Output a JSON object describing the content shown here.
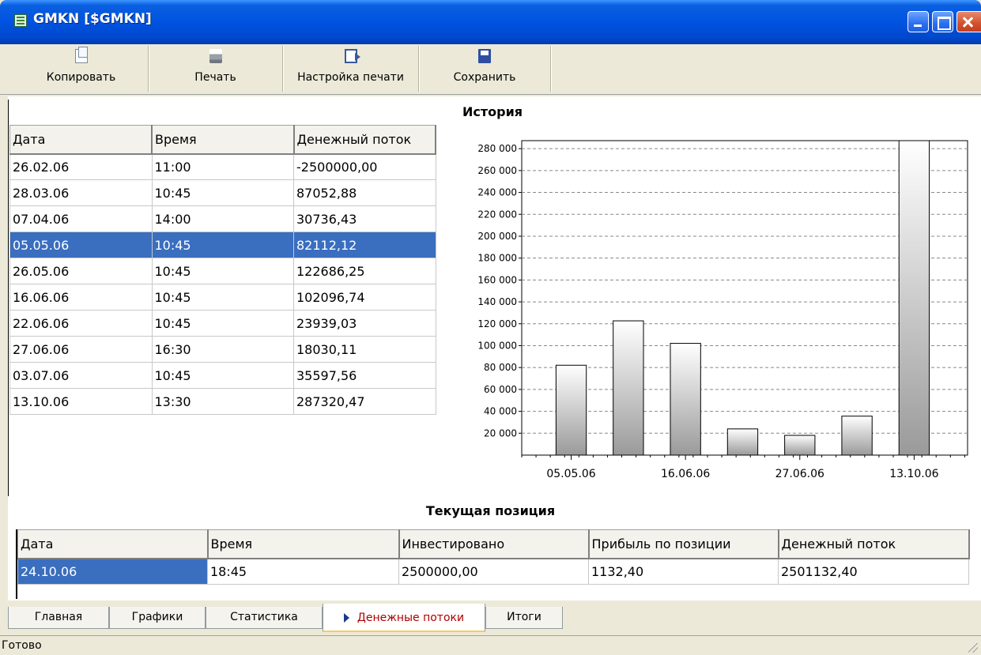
{
  "window": {
    "title": "GMKN [$GMKN]"
  },
  "toolbar": {
    "copy_label": "Копировать",
    "print_label": "Печать",
    "print_setup_label": "Настройка печати",
    "save_label": "Сохранить"
  },
  "history": {
    "columns": [
      "Дата",
      "Время",
      "Денежный поток"
    ],
    "rows": [
      [
        "26.02.06",
        "11:00",
        "-2500000,00"
      ],
      [
        "28.03.06",
        "10:45",
        "87052,88"
      ],
      [
        "07.04.06",
        "14:00",
        "30736,43"
      ],
      [
        "05.05.06",
        "10:45",
        "82112,12"
      ],
      [
        "26.05.06",
        "10:45",
        "122686,25"
      ],
      [
        "16.06.06",
        "10:45",
        "102096,74"
      ],
      [
        "22.06.06",
        "10:45",
        "23939,03"
      ],
      [
        "27.06.06",
        "16:30",
        "18030,11"
      ],
      [
        "03.07.06",
        "10:45",
        "35597,56"
      ],
      [
        "13.10.06",
        "13:30",
        "287320,47"
      ]
    ],
    "selected_row": 3
  },
  "chart_data": {
    "type": "bar",
    "title": "История",
    "categories": [
      "05.05.06",
      "26.05.06",
      "16.06.06",
      "22.06.06",
      "27.06.06",
      "03.07.06",
      "13.10.06"
    ],
    "x_tick_labels": [
      "05.05.06",
      "16.06.06",
      "27.06.06",
      "13.10.06"
    ],
    "values": [
      82112.12,
      122686.25,
      102096.74,
      23939.03,
      18030.11,
      35597.56,
      287320.47
    ],
    "y_ticks": [
      20000,
      40000,
      60000,
      80000,
      100000,
      120000,
      140000,
      160000,
      180000,
      200000,
      220000,
      240000,
      260000,
      280000
    ],
    "y_tick_labels": [
      "20 000",
      "40 000",
      "60 000",
      "80 000",
      "100 000",
      "120 000",
      "140 000",
      "160 000",
      "180 000",
      "200 000",
      "220 000",
      "240 000",
      "260 000",
      "280 000"
    ],
    "ylim": [
      0,
      287320.47
    ],
    "grid": true
  },
  "position": {
    "title": "Текущая позиция",
    "columns": [
      "Дата",
      "Время",
      "Инвестировано",
      "Прибыль по позиции",
      "Денежный поток"
    ],
    "row": [
      "24.10.06",
      "18:45",
      "2500000,00",
      "1132,40",
      "2501132,40"
    ]
  },
  "tabs": [
    "Главная",
    "Графики",
    "Статистика",
    "Денежные потоки",
    "Итоги"
  ],
  "active_tab": "Денежные потоки",
  "status": "Готово"
}
